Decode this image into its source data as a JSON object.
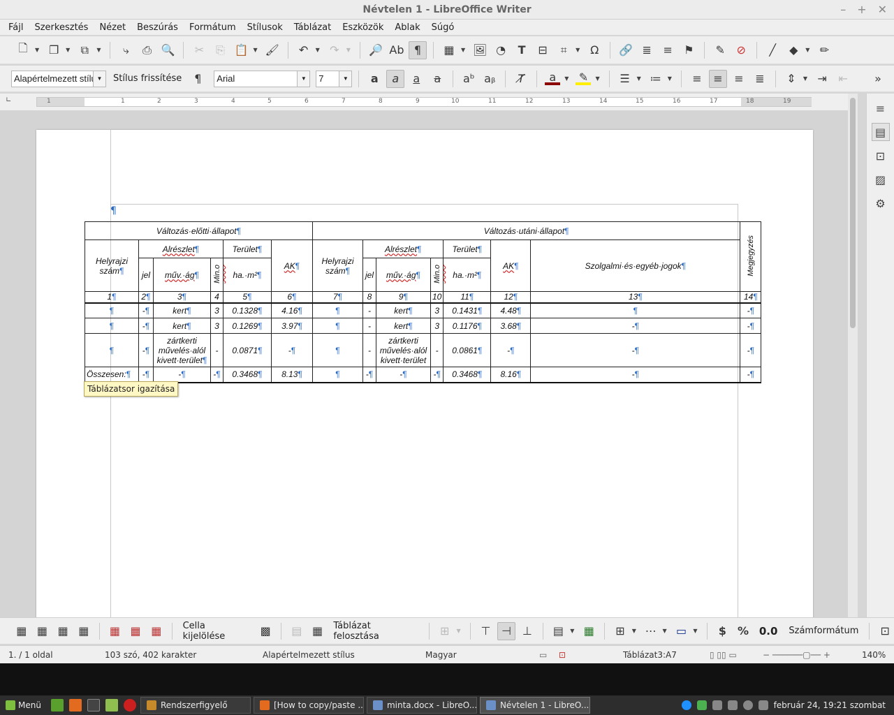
{
  "window": {
    "title": "Névtelen 1 - LibreOffice Writer",
    "controls": [
      "–",
      "+",
      "✕"
    ]
  },
  "menu": [
    "Fájl",
    "Szerkesztés",
    "Nézet",
    "Beszúrás",
    "Formátum",
    "Stílusok",
    "Táblázat",
    "Eszközök",
    "Ablak",
    "Súgó"
  ],
  "format_bar": {
    "paragraph_style": "Alapértelmezett stílu",
    "update_style_label": "Stílus frissítése",
    "font_name": "Arial",
    "font_size": "7",
    "font_color": "#8b0000",
    "highlight_color": "#ffee00"
  },
  "ruler": {
    "numbers": [
      "1",
      "1",
      "2",
      "3",
      "4",
      "5",
      "6",
      "7",
      "8",
      "9",
      "10",
      "11",
      "12",
      "13",
      "14",
      "15",
      "16",
      "17",
      "18",
      "19"
    ]
  },
  "document": {
    "table": {
      "before_header": "Változás·előtti·állapot",
      "after_header": "Változás·utáni·állapot",
      "megjegyzes": "Megjegyzés",
      "helyrajzi": "Helyrajzi szám",
      "alreszlet": "Alrészlet",
      "terulet": "Terület",
      "ak": "AK",
      "jel": "jel",
      "muv_ag": "műv.·ág",
      "min_o": "Min.o",
      "ha_m2": "ha.·m²",
      "szolgalmi": "Szolgalmi·és·egyéb·jogok",
      "numbers": [
        "1",
        "2",
        "3",
        "4",
        "5",
        "6",
        "7",
        "8",
        "9",
        "10",
        "11",
        "12",
        "13",
        "14"
      ],
      "rows": [
        [
          "",
          "-",
          "kert",
          "3",
          "0.1328",
          "4.16",
          "",
          "-",
          "kert",
          "3",
          "0.1431",
          "4.48",
          "",
          "-"
        ],
        [
          "",
          "-",
          "kert",
          "3",
          "0.1269",
          "3.97",
          "",
          "-",
          "kert",
          "3",
          "0.1176",
          "3.68",
          "-",
          "-"
        ],
        [
          "",
          "-",
          "zártkerti művelés·alól kivett·terület",
          "-",
          "0.0871",
          "-",
          "",
          "-",
          "zártkerti művelés·alól kivett·terület",
          "-",
          "0.0861",
          "-",
          "-",
          "-"
        ]
      ],
      "total": [
        "Összesen:",
        "-",
        "-",
        "-",
        "0.3468",
        "8.13",
        "",
        "-",
        "-",
        "-",
        "0.3468",
        "8.16",
        "-",
        "-"
      ]
    },
    "tooltip": "Táblázatsor igazítása"
  },
  "table_bar": {
    "select_cell": "Cella kijelölése",
    "split_table": "Táblázat felosztása",
    "decimal": "0.0",
    "number_format": "Számformátum"
  },
  "status": {
    "page": "1. / 1 oldal",
    "words": "103 szó, 402 karakter",
    "style": "Alapértelmezett stílus",
    "language": "Magyar",
    "cell": "Táblázat3:A7",
    "zoom": "140%"
  },
  "taskbar": {
    "menu": "Menü",
    "tasks": [
      "Rendszerfigyelő",
      "[How to copy/paste ...",
      "minta.docx - LibreO...",
      "Névtelen 1 - LibreO..."
    ],
    "clock": "február 24, 19:21 szombat"
  }
}
